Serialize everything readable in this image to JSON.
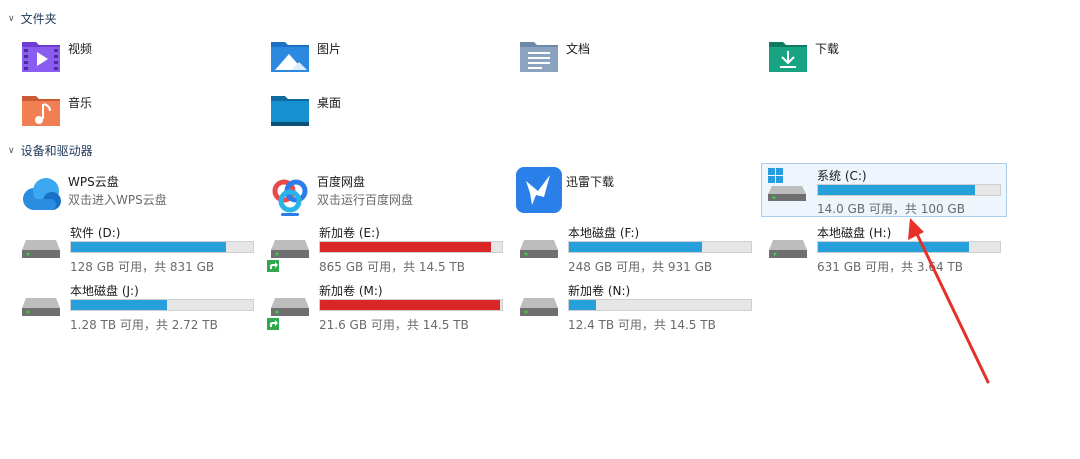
{
  "sections": {
    "folders_title": "文件夹",
    "devices_title": "设备和驱动器"
  },
  "folders": [
    {
      "label": "视频",
      "icon": "video-folder-icon"
    },
    {
      "label": "图片",
      "icon": "pictures-folder-icon"
    },
    {
      "label": "文档",
      "icon": "documents-folder-icon"
    },
    {
      "label": "下载",
      "icon": "downloads-folder-icon"
    },
    {
      "label": "音乐",
      "icon": "music-folder-icon"
    },
    {
      "label": "桌面",
      "icon": "desktop-folder-icon"
    }
  ],
  "services": [
    {
      "name": "WPS云盘",
      "sub": "双击进入WPS云盘",
      "icon": "wps-cloud-icon"
    },
    {
      "name": "百度网盘",
      "sub": "双击运行百度网盘",
      "icon": "baidu-netdisk-icon"
    },
    {
      "name": "迅雷下载",
      "sub": "",
      "icon": "xunlei-icon"
    }
  ],
  "drives": [
    {
      "name": "系统 (C:)",
      "info": "14.0 GB 可用，共 100 GB",
      "used_fraction": 0.86,
      "color": "#26a0da",
      "selected": true,
      "system": true
    },
    {
      "name": "软件 (D:)",
      "info": "128 GB 可用，共 831 GB",
      "used_fraction": 0.85,
      "color": "#26a0da"
    },
    {
      "name": "新加卷 (E:)",
      "info": "865 GB 可用，共 14.5 TB",
      "used_fraction": 0.94,
      "color": "#da2626",
      "shortcut": true
    },
    {
      "name": "本地磁盘 (F:)",
      "info": "248 GB 可用，共 931 GB",
      "used_fraction": 0.73,
      "color": "#26a0da"
    },
    {
      "name": "本地磁盘 (H:)",
      "info": "631 GB 可用，共 3.64 TB",
      "used_fraction": 0.83,
      "color": "#26a0da"
    },
    {
      "name": "本地磁盘 (J:)",
      "info": "1.28 TB 可用，共 2.72 TB",
      "used_fraction": 0.53,
      "color": "#26a0da"
    },
    {
      "name": "新加卷 (M:)",
      "info": "21.6 GB 可用，共 14.5 TB",
      "used_fraction": 0.99,
      "color": "#da2626",
      "shortcut": true
    },
    {
      "name": "新加卷 (N:)",
      "info": "12.4 TB 可用，共 14.5 TB",
      "used_fraction": 0.15,
      "color": "#26a0da"
    }
  ],
  "colors": {
    "bar_blue": "#26a0da",
    "bar_red": "#da2626",
    "annotation_arrow": "#e8302a"
  }
}
